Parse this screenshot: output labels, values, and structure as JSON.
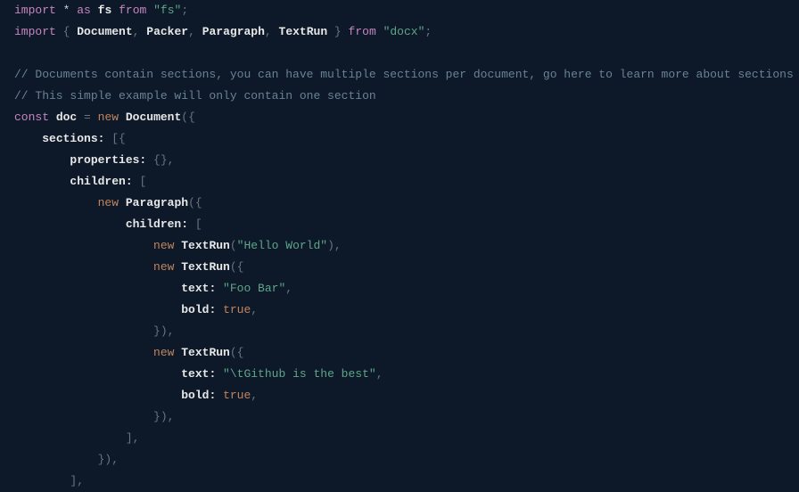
{
  "code": {
    "line1": {
      "kw_import": "import",
      "star": "*",
      "kw_as": "as",
      "ident_fs": "fs",
      "kw_from": "from",
      "str_fs": "\"fs\"",
      "semi": ";"
    },
    "line2": {
      "kw_import": "import",
      "brace_open": "{ ",
      "ident_document": "Document",
      "comma1": ", ",
      "ident_packer": "Packer",
      "comma2": ", ",
      "ident_paragraph": "Paragraph",
      "comma3": ", ",
      "ident_textrun": "TextRun",
      "brace_close": " }",
      "kw_from": "from",
      "str_docx": "\"docx\"",
      "semi": ";"
    },
    "line4": {
      "comment": "// Documents contain sections, you can have multiple sections per document, go here to learn more about sections"
    },
    "line5": {
      "comment": "// This simple example will only contain one section"
    },
    "line6": {
      "kw_const": "const",
      "ident_doc": "doc",
      "eq": " = ",
      "kw_new": "new",
      "classname": "Document",
      "parens": "({"
    },
    "line7": {
      "indent": "    ",
      "prop": "sections:",
      "brackets": " [{"
    },
    "line8": {
      "indent": "        ",
      "prop": "properties:",
      "braces": " {},"
    },
    "line9": {
      "indent": "        ",
      "prop": "children:",
      "bracket": " ["
    },
    "line10": {
      "indent": "            ",
      "kw_new": "new",
      "classname": "Paragraph",
      "parens": "({"
    },
    "line11": {
      "indent": "                ",
      "prop": "children:",
      "bracket": " ["
    },
    "line12": {
      "indent": "                    ",
      "kw_new": "new",
      "classname": "TextRun",
      "paren_open": "(",
      "str": "\"Hello World\"",
      "paren_close": "),"
    },
    "line13": {
      "indent": "                    ",
      "kw_new": "new",
      "classname": "TextRun",
      "parens": "({"
    },
    "line14": {
      "indent": "                        ",
      "prop": "text:",
      "str": " \"Foo Bar\"",
      "comma": ","
    },
    "line15": {
      "indent": "                        ",
      "prop": "bold:",
      "sp": " ",
      "bool": "true",
      "comma": ","
    },
    "line16": {
      "indent": "                    ",
      "close": "}),"
    },
    "line17": {
      "indent": "                    ",
      "kw_new": "new",
      "classname": "TextRun",
      "parens": "({"
    },
    "line18": {
      "indent": "                        ",
      "prop": "text:",
      "str": " \"\\tGithub is the best\"",
      "comma": ","
    },
    "line19": {
      "indent": "                        ",
      "prop": "bold:",
      "sp": " ",
      "bool": "true",
      "comma": ","
    },
    "line20": {
      "indent": "                    ",
      "close": "}),"
    },
    "line21": {
      "indent": "                ",
      "close": "],"
    },
    "line22": {
      "indent": "            ",
      "close": "}),"
    },
    "line23": {
      "indent": "        ",
      "close": "],"
    }
  }
}
